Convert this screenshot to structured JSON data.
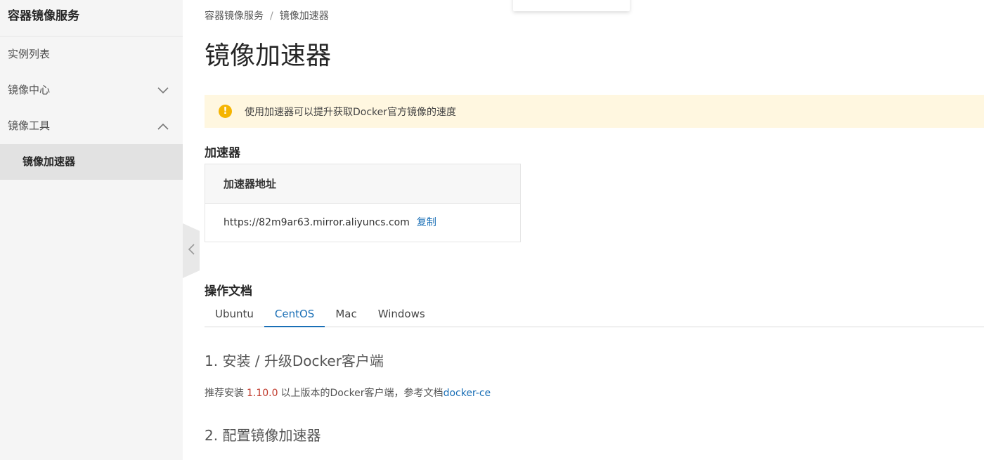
{
  "sidebar": {
    "title": "容器镜像服务",
    "items": [
      {
        "label": "实例列表",
        "chevron": ""
      },
      {
        "label": "镜像中心",
        "chevron": "chevron-down-icon"
      },
      {
        "label": "镜像工具",
        "chevron": "chevron-up-icon"
      }
    ],
    "active_sub": "镜像加速器"
  },
  "breadcrumb": {
    "root": "容器镜像服务",
    "sep": "/",
    "current": "镜像加速器"
  },
  "page_title": "镜像加速器",
  "alert": {
    "text": "使用加速器可以提升获取Docker官方镜像的速度",
    "icon": "warning-icon",
    "bg": "#fff7e0",
    "icon_color": "#f5b400"
  },
  "accelerator": {
    "section_title": "加速器",
    "header": "加速器地址",
    "url": "https://82m9ar63.mirror.aliyuncs.com",
    "copy_label": "复制"
  },
  "docs": {
    "section_title": "操作文档",
    "tabs": [
      "Ubuntu",
      "CentOS",
      "Mac",
      "Windows"
    ],
    "active_tab": "CentOS",
    "step1_title": "1. 安装 / 升级Docker客户端",
    "step1_pre": "推荐安装",
    "step1_version": "1.10.0",
    "step1_mid": "以上版本的Docker客户端，参考文档",
    "step1_link": "docker-ce",
    "step2_title": "2. 配置镜像加速器"
  },
  "colors": {
    "accent": "#1a6fb6",
    "version": "#c0392b"
  }
}
